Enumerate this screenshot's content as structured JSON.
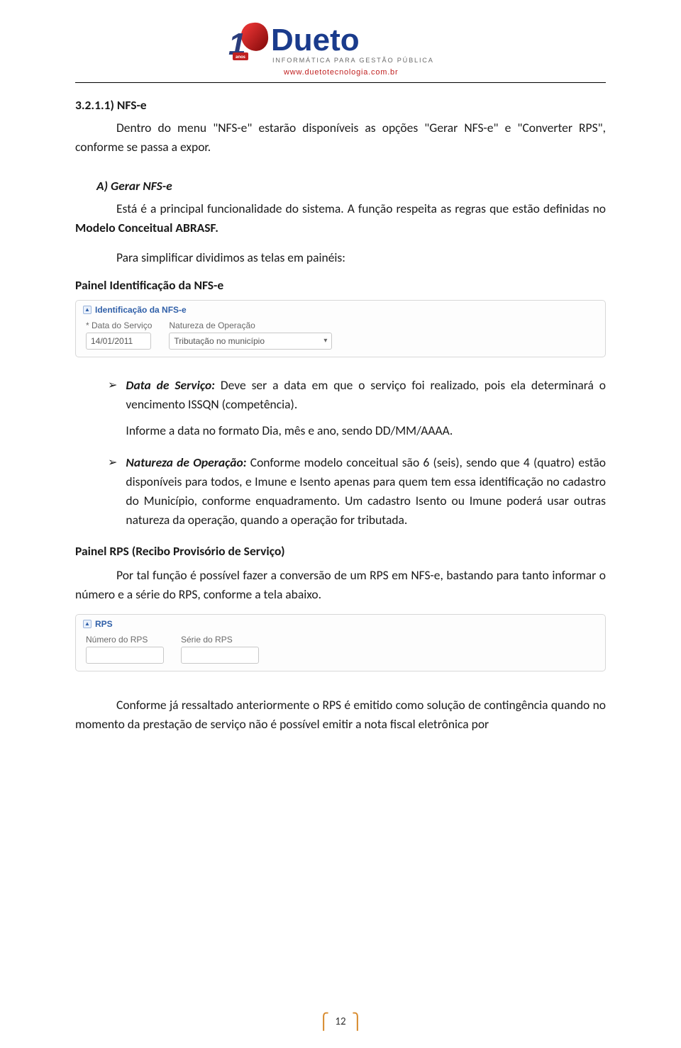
{
  "logo": {
    "word": "Dueto",
    "one": "1",
    "anos": "anos",
    "tagline": "INFORMÁTICA PARA GESTÃO PÚBLICA",
    "url": "www.duetotecnologia.com.br"
  },
  "section_num": "3.2.1.1) NFS-e",
  "intro": "Dentro do menu \"NFS-e\" estarão disponíveis as opções \"Gerar NFS-e\" e \"Converter RPS\", conforme se passa a expor.",
  "sub_a": "A) Gerar NFS-e",
  "para_a1": "Está é a principal funcionalidade do sistema. A função respeita as regras que estão definidas no ",
  "para_a1_bold": "Modelo Conceitual ABRASF.",
  "para_a2": "Para simplificar dividimos as telas em painéis:",
  "panel1_heading": "Painel Identificação da NFS-e",
  "screenshot1": {
    "panel_title": "Identificação da NFS-e",
    "field1_label": "* Data do Serviço",
    "field1_value": "14/01/2011",
    "field2_label": "Natureza de Operação",
    "field2_value": "Tributação no município"
  },
  "bullets": [
    {
      "title": "Data de Serviço:",
      "body1": "Deve ser a data em que o serviço foi realizado, pois ela determinará o vencimento ISSQN (competência).",
      "body2": "Informe a data no formato Dia, mês e ano, sendo DD/MM/AAAA."
    },
    {
      "title": "Natureza de Operação:",
      "body1": "Conforme modelo conceitual são 6 (seis), sendo que 4 (quatro) estão disponíveis para todos, e Imune e Isento apenas para quem tem essa identificação no cadastro do Município, conforme enquadramento. Um cadastro Isento ou Imune poderá usar outras natureza da operação, quando a operação for tributada."
    }
  ],
  "panel2_heading": "Painel RPS (Recibo Provisório de Serviço)",
  "para_rps": "Por tal função é possível fazer a conversão de um RPS em NFS-e, bastando para tanto informar o número e a série do RPS, conforme a tela abaixo.",
  "screenshot2": {
    "panel_title": "RPS",
    "field1_label": "Número do RPS",
    "field2_label": "Série do RPS"
  },
  "para_final": "Conforme já ressaltado anteriormente o RPS é emitido como solução de contingência quando no momento da prestação de serviço não é possível emitir a nota fiscal eletrônica por",
  "page_number": "12"
}
